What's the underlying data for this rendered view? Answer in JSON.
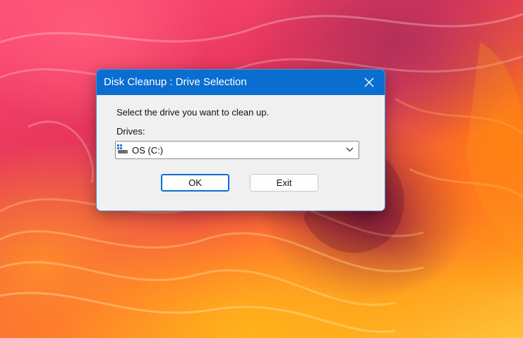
{
  "dialog": {
    "title": "Disk Cleanup : Drive Selection",
    "prompt": "Select the drive you want to clean up.",
    "drives_label": "Drives:",
    "selected_drive": "OS (C:)",
    "ok_label": "OK",
    "exit_label": "Exit"
  },
  "icons": {
    "close": "close-icon",
    "drive": "hard-drive-icon",
    "dropdown": "chevron-down-icon"
  },
  "colors": {
    "title_bar": "#0a6ed1",
    "dialog_bg": "#f0f0f0",
    "default_button_border": "#0a6ed1"
  }
}
